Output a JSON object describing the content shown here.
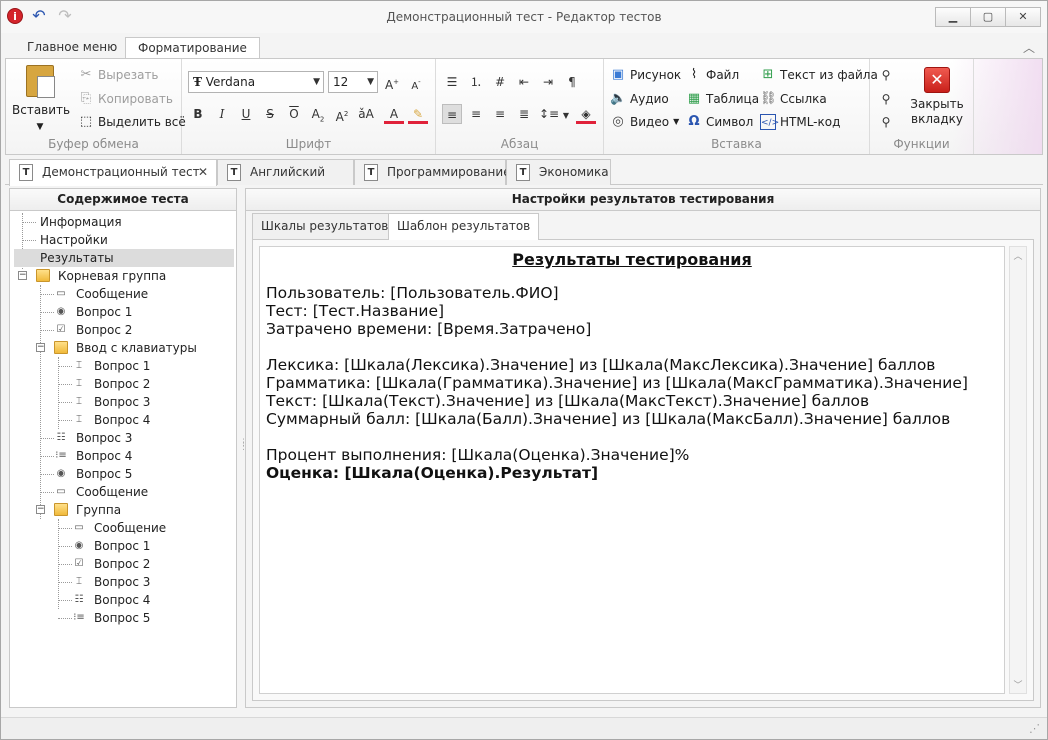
{
  "window": {
    "title": "Демонстрационный тест - Редактор тестов"
  },
  "ribbon_tabs": [
    "Главное меню",
    "Форматирование"
  ],
  "clipboard": {
    "label": "Буфер обмена",
    "paste": "Вставить",
    "cut": "Вырезать",
    "copy": "Копировать",
    "select_all": "Выделить всё"
  },
  "font": {
    "label": "Шрифт",
    "family": "Verdana",
    "size": "12"
  },
  "paragraph": {
    "label": "Абзац"
  },
  "insert": {
    "label": "Вставка",
    "picture": "Рисунок",
    "audio": "Аудио",
    "video": "Видео",
    "file": "Файл",
    "table": "Таблица",
    "symbol": "Символ",
    "text_from_file": "Текст из файла",
    "link": "Ссылка",
    "html": "HTML-код"
  },
  "functions": {
    "label": "Функции",
    "close_tab": [
      "Закрыть",
      "вкладку"
    ]
  },
  "doc_tabs": [
    "Демонстрационный тест",
    "Английский язык",
    "Программирование",
    "Экономика"
  ],
  "left_panel": {
    "title": "Содержимое теста",
    "items": [
      "Информация",
      "Настройки",
      "Результаты",
      "Корневая группа",
      "Сообщение",
      "Вопрос 1",
      "Вопрос 2",
      "Ввод с клавиатуры",
      "Вопрос 1",
      "Вопрос 2",
      "Вопрос 3",
      "Вопрос 4",
      "Вопрос 3",
      "Вопрос 4",
      "Вопрос 5",
      "Сообщение",
      "Группа",
      "Сообщение",
      "Вопрос 1",
      "Вопрос 2",
      "Вопрос 3",
      "Вопрос 4",
      "Вопрос 5"
    ]
  },
  "right_panel": {
    "title": "Настройки результатов тестирования",
    "tabs": [
      "Шкалы результатов",
      "Шаблон результатов"
    ],
    "template": {
      "title": "Результаты тестирования",
      "lines": [
        "Пользователь: [Пользователь.ФИО]",
        "Тест: [Тест.Название]",
        "Затрачено времени: [Время.Затрачено]",
        "",
        "Лексика: [Шкала(Лексика).Значение] из [Шкала(МаксЛексика).Значение] баллов",
        "Грамматика: [Шкала(Грамматика).Значение] из [Шкала(МаксГрамматика).Значение]",
        "Текст: [Шкала(Текст).Значение] из [Шкала(МаксТекст).Значение] баллов",
        "Суммарный балл: [Шкала(Балл).Значение] из [Шкала(МаксБалл).Значение] баллов",
        "",
        "Процент выполнения: [Шкала(Оценка).Значение]%"
      ],
      "bold_line": "Оценка: [Шкала(Оценка).Результат]"
    }
  }
}
